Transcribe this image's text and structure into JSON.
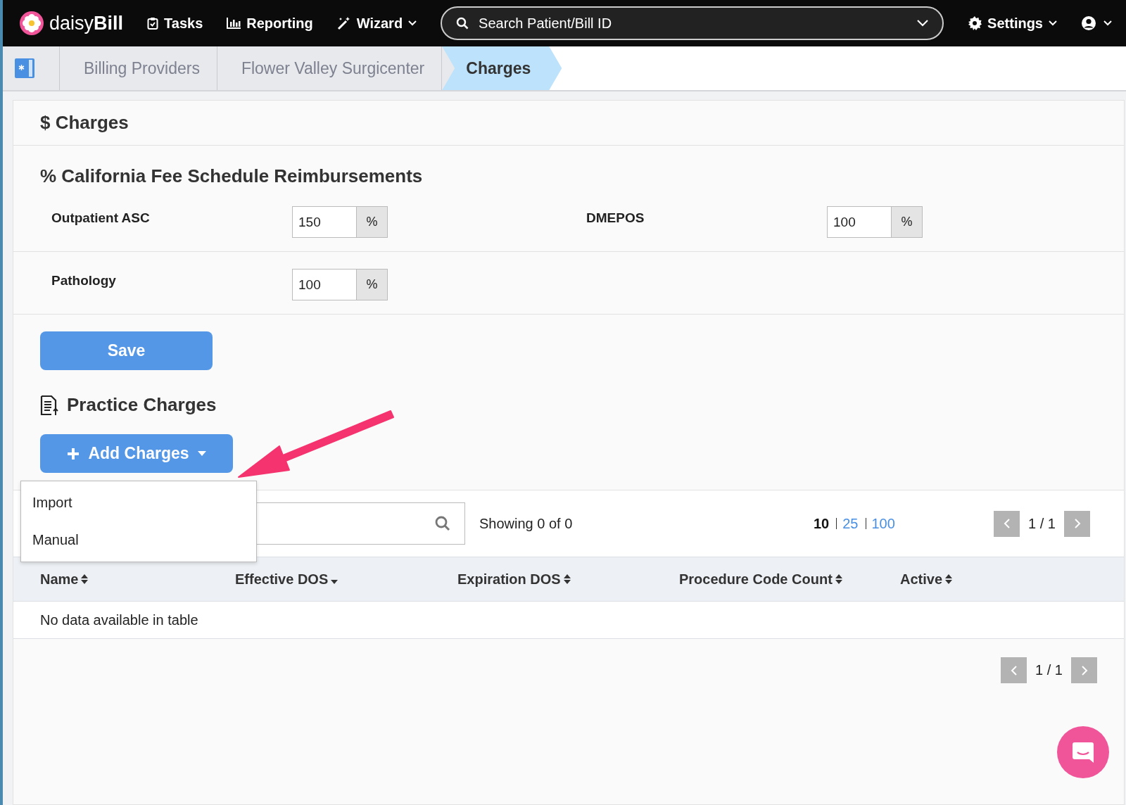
{
  "navbar": {
    "brand_light": "daisy",
    "brand_bold": "Bill",
    "items": [
      {
        "label": "Tasks",
        "dropdown": false
      },
      {
        "label": "Reporting",
        "dropdown": false
      },
      {
        "label": "Wizard",
        "dropdown": true
      }
    ],
    "search": {
      "placeholder": "Search Patient/Bill ID"
    },
    "settings": {
      "label": "Settings"
    }
  },
  "breadcrumb": [
    {
      "label": "Billing Providers",
      "selected": false
    },
    {
      "label": "Flower Valley Surgicenter",
      "selected": false
    },
    {
      "label": "Charges",
      "selected": true
    }
  ],
  "page_title": {
    "icon": "$",
    "text": "Charges"
  },
  "fee_schedule": {
    "icon": "%",
    "title": "California Fee Schedule Reimbursements",
    "fields": [
      {
        "label": "Outpatient ASC",
        "value": "150",
        "unit": "%"
      },
      {
        "label": "DMEPOS",
        "value": "100",
        "unit": "%"
      },
      {
        "label": "Pathology",
        "value": "100",
        "unit": "%"
      }
    ],
    "save": "Save"
  },
  "practice_charges": {
    "title": "Practice Charges",
    "add_button": "Add Charges",
    "menu": [
      "Import",
      "Manual"
    ],
    "showing": "Showing 0 of 0",
    "page_sizes": [
      {
        "label": "10",
        "selected": true
      },
      {
        "label": "25",
        "selected": false
      },
      {
        "label": "100",
        "selected": false
      }
    ],
    "page": "1 / 1",
    "columns": [
      {
        "label": "Name",
        "sorted": false
      },
      {
        "label": "Effective DOS",
        "sorted": true
      },
      {
        "label": "Expiration DOS",
        "sorted": false
      },
      {
        "label": "Procedure Code Count",
        "sorted": false
      },
      {
        "label": "Active",
        "sorted": false
      }
    ],
    "empty": "No data available in table",
    "bottom_page": "1 / 1"
  }
}
